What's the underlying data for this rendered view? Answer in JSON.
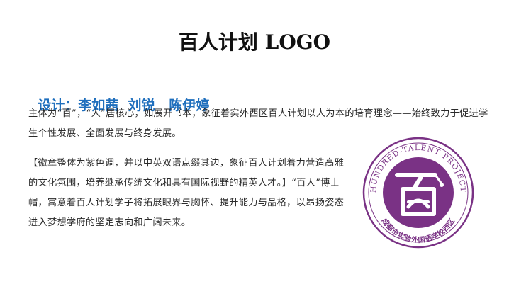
{
  "page": {
    "title": "百人计划 LOGO",
    "designer_label": "设计：",
    "designer_names": "李如茜  刘锐   陈伊婷",
    "paragraph1": "主体为“百”，“人”居核心，如展开书本，象征着实外西区百人计划以人为本的培育理念——始终致力于促进学生个性发展、全面发展与终身发展。",
    "paragraph2": "【徽章整体为紫色调，并以中英双语点缀其边，象征百人计划着力营造高雅的文化氛围，培养继承传统文化和具有国际视野的精英人才。】“百人”博士帽，寓意着百人计划学子将拓展眼界与胸怀、提升能力与品格，以昂扬姿态进入梦想学府的坚定志向和广阔未来。"
  },
  "logo": {
    "english_text": "HUNDRED-TALENT PROJECT",
    "chinese_text": "成都市实验外国语学校西区",
    "center_char": "百"
  },
  "colors": {
    "heading_blue": "#1f6fbd",
    "logo_purple": "#7a3285",
    "logo_light": "#f3e9f6"
  }
}
